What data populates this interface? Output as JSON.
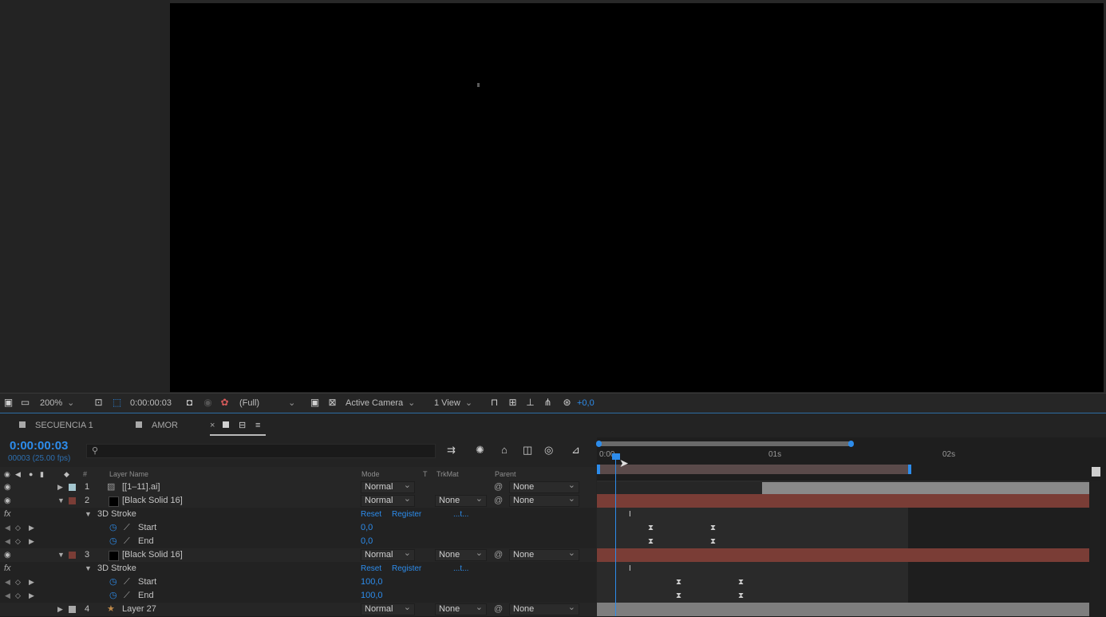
{
  "viewer": {
    "zoom": "200%",
    "timecode": "0:00:00:03",
    "resolution": "(Full)",
    "camera": "Active Camera",
    "views": "1 View",
    "exposure": "+0,0"
  },
  "tabs": [
    {
      "label": "SECUENCIA 1"
    },
    {
      "label": "AMOR"
    },
    {
      "label": "×"
    }
  ],
  "timeline": {
    "timecode": "0:00:00:03",
    "frame_fps": "00003 (25.00 fps)",
    "search_placeholder": "",
    "columns": {
      "num": "#",
      "layer_name": "Layer Name",
      "mode": "Mode",
      "t": "T",
      "trkmat": "TrkMat",
      "parent": "Parent"
    },
    "ruler": {
      "t0": "0:00",
      "t1": "01s",
      "t2": "02s"
    },
    "rows": {
      "r1": {
        "num": "1",
        "name": "[[1–11].ai]",
        "mode": "Normal",
        "parent": "None"
      },
      "r2": {
        "num": "2",
        "name": "[Black Solid 16]",
        "mode": "Normal",
        "trkmat": "None",
        "parent": "None"
      },
      "r2fx": {
        "fx": "fx",
        "name": "3D Stroke",
        "reset": "Reset",
        "register": "Register",
        "dots": "...t..."
      },
      "r2start": {
        "name": "Start",
        "value": "0,0"
      },
      "r2end": {
        "name": "End",
        "value": "0,0"
      },
      "r3": {
        "num": "3",
        "name": "[Black Solid 16]",
        "mode": "Normal",
        "trkmat": "None",
        "parent": "None"
      },
      "r3fx": {
        "fx": "fx",
        "name": "3D Stroke",
        "reset": "Reset",
        "register": "Register",
        "dots": "...t..."
      },
      "r3start": {
        "name": "Start",
        "value": "100,0"
      },
      "r3end": {
        "name": "End",
        "value": "100,0"
      },
      "r4": {
        "num": "4",
        "name": "Layer 27",
        "mode": "Normal",
        "trkmat": "None",
        "parent": "None"
      }
    }
  },
  "colors": {
    "accent": "#2d8ceb",
    "red_label": "#7a3d36",
    "cyan_label": "#a3c6cf"
  }
}
